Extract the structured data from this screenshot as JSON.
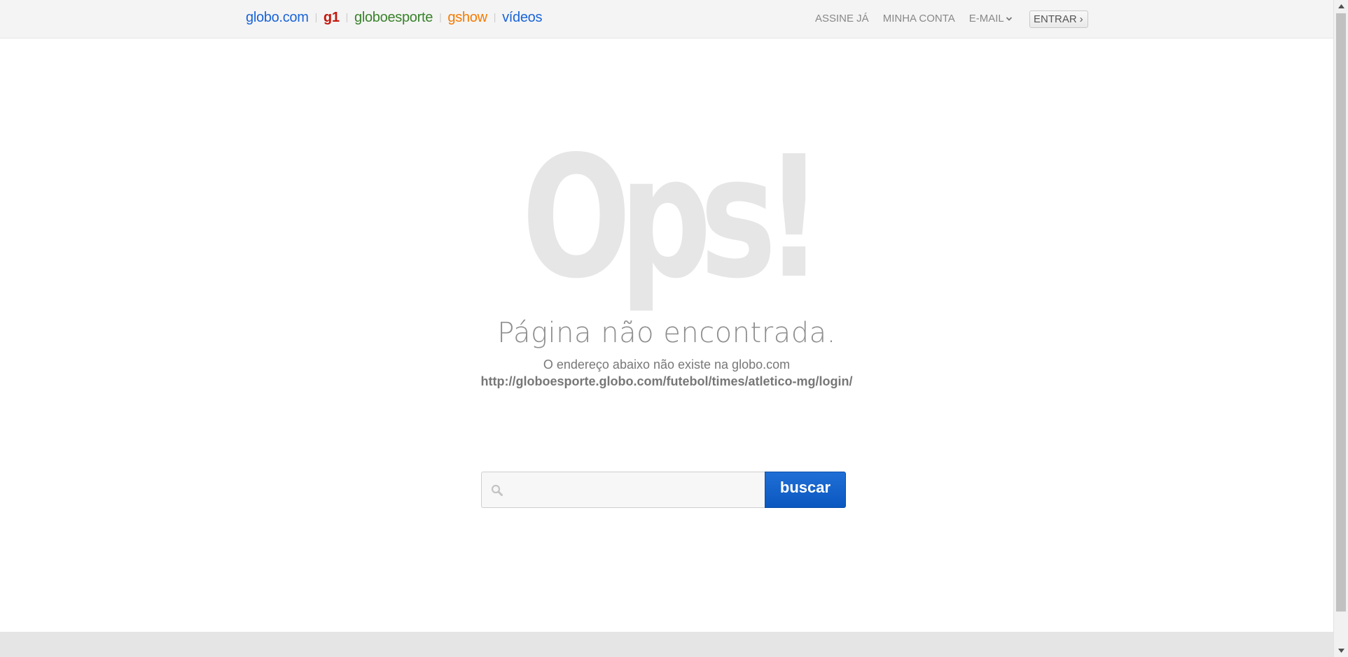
{
  "header": {
    "brands": [
      {
        "label": "globo.com",
        "key": "globo"
      },
      {
        "label": "g1",
        "key": "g1"
      },
      {
        "label": "globoesporte",
        "key": "ge"
      },
      {
        "label": "gshow",
        "key": "gshow"
      },
      {
        "label": "vídeos",
        "key": "videos"
      }
    ],
    "user_links": {
      "subscribe": "ASSINE JÁ",
      "account": "MINHA CONTA",
      "email": "E-MAIL",
      "login": "ENTRAR",
      "login_arrow": "›"
    }
  },
  "error": {
    "graphic_text": "Ops!",
    "title": "Página não encontrada.",
    "subtitle": "O endereço abaixo não existe na globo.com",
    "url": "http://globoesporte.globo.com/futebol/times/atletico-mg/login/"
  },
  "search": {
    "value": "",
    "placeholder": "",
    "button_label": "buscar"
  },
  "colors": {
    "globo_blue": "#1a64d8",
    "g1_red": "#c4170c",
    "ge_green": "#39822b",
    "gshow_orange": "#f47b00",
    "ops_gray": "#e6e6e6",
    "button_blue": "#0a57c0"
  },
  "icons": {
    "search": "magnifier-icon",
    "email_dropdown": "chevron-down-icon",
    "scroll_up": "triangle-up-icon",
    "scroll_down": "triangle-down-icon"
  }
}
